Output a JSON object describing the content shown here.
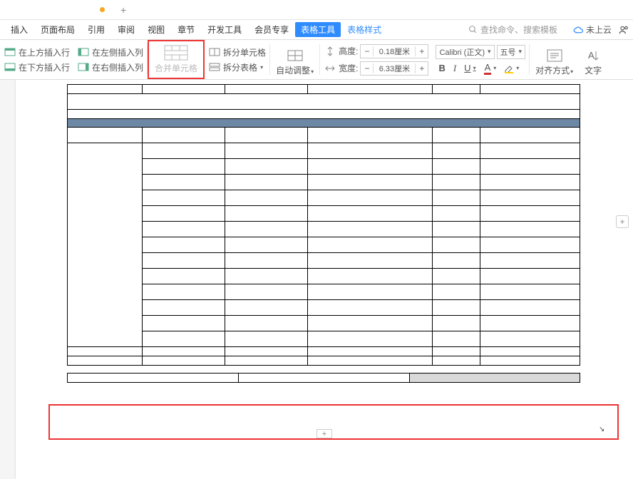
{
  "tabbar": {
    "plus": "+"
  },
  "menu": {
    "items": [
      "插入",
      "页面布局",
      "引用",
      "审阅",
      "视图",
      "章节",
      "开发工具",
      "会员专享"
    ],
    "active": "表格工具",
    "style_link": "表格样式",
    "search_placeholder": "查找命令、搜索模板",
    "cloud_label": "未上云"
  },
  "toolbar": {
    "insert_above": "在上方插入行",
    "insert_below": "在下方插入行",
    "insert_left": "在左侧插入列",
    "insert_right": "在右侧插入列",
    "merge_cells": "合并单元格",
    "split_cells": "拆分单元格",
    "split_table": "拆分表格",
    "auto_fit": "自动调整",
    "height_label": "高度:",
    "height_value": "0.18厘米",
    "width_label": "宽度:",
    "width_value": "6.33厘米",
    "minus": "−",
    "plus": "+",
    "font_name": "Calibri (正文)",
    "font_size": "五号",
    "align_label": "对齐方式",
    "text_dir_label": "文字"
  },
  "font": {
    "bold": "B",
    "italic": "I",
    "underline": "U",
    "color_a": "A"
  },
  "caret": "▾"
}
